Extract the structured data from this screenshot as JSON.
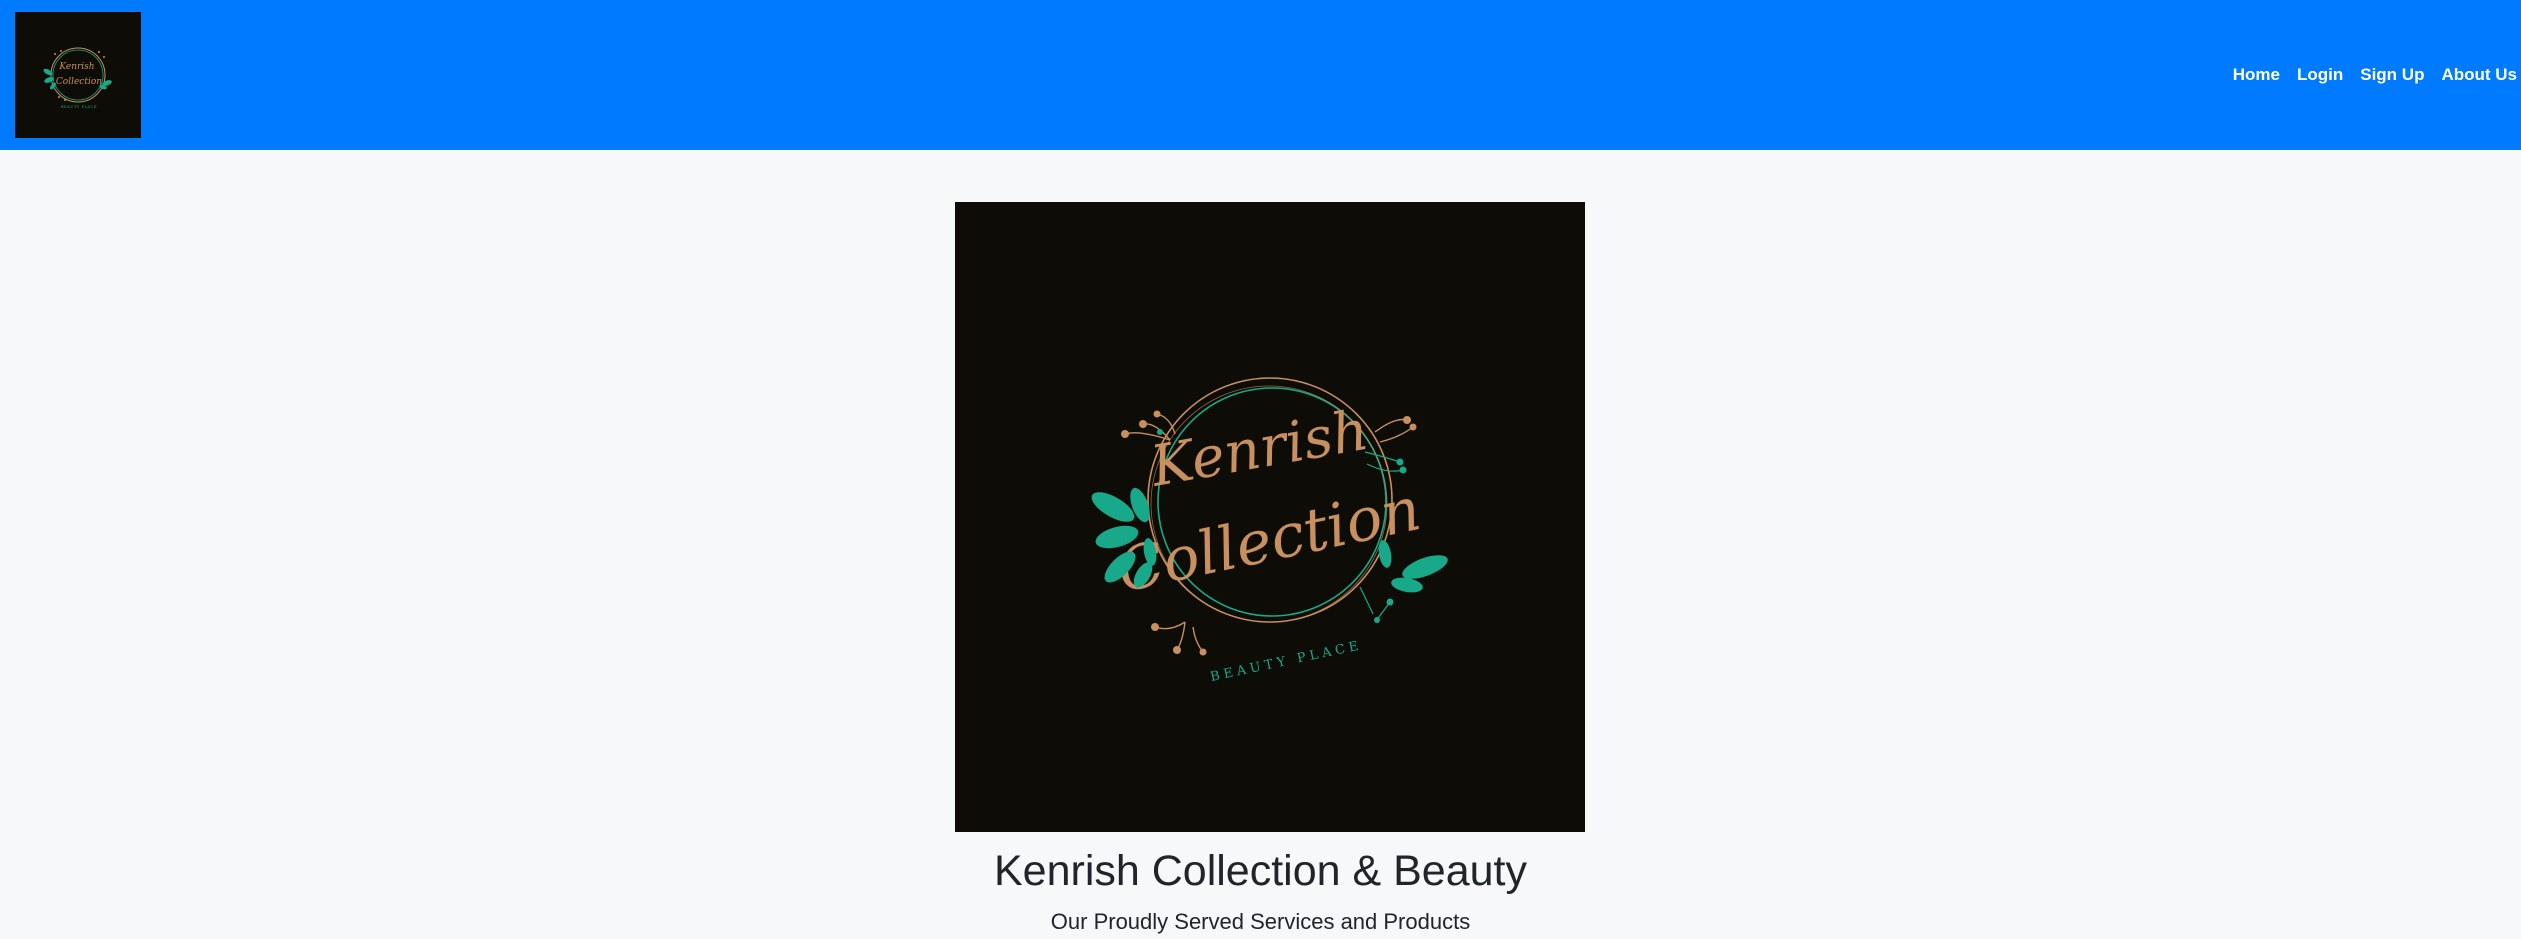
{
  "navbar": {
    "logo": {
      "name": "Kenrish Collection",
      "script_line1": "Kenrish",
      "script_line2": "Collection",
      "tagline": "BEAUTY PLACE"
    },
    "links": [
      {
        "label": "Home"
      },
      {
        "label": "Login"
      },
      {
        "label": "Sign Up"
      },
      {
        "label": "About Us"
      }
    ]
  },
  "hero": {
    "logo": {
      "script_line1": "Kenrish",
      "script_line2": "Collection",
      "tagline": "BEAUTY PLACE"
    },
    "title": "Kenrish Collection & Beauty",
    "subtitle": "Our Proudly Served Services and Products"
  },
  "colors": {
    "navbar_bg": "#007bff",
    "page_bg": "#f7f8fa",
    "logo_bg": "#0e0c06",
    "logo_gold": "#c8905e",
    "logo_teal": "#17a98a",
    "text_dark": "#212529"
  },
  "icons": {
    "leaf": "leaf-icon"
  }
}
